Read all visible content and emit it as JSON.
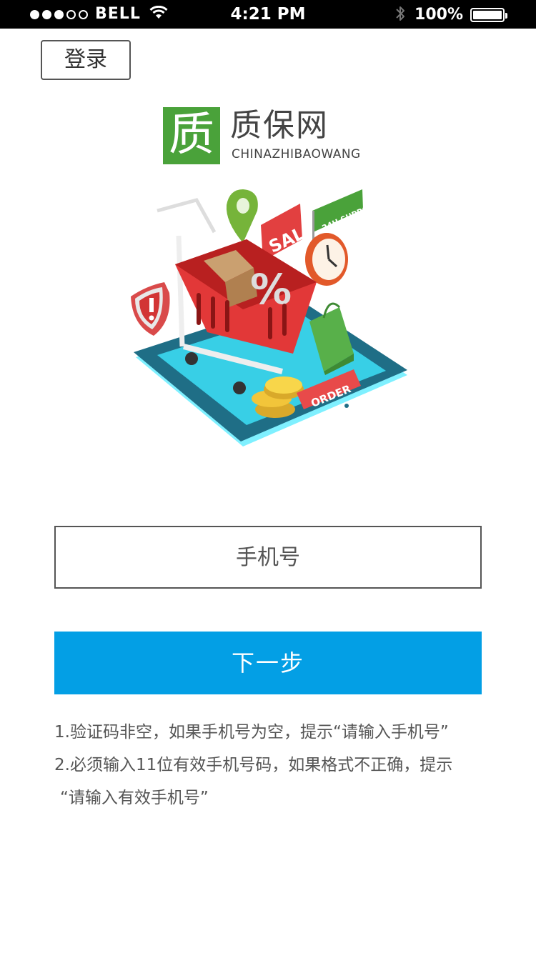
{
  "status_bar": {
    "carrier": "BELL",
    "signal_dots": 5,
    "signal_filled": 3,
    "time": "4:21 PM",
    "battery_percent": "100%",
    "icons": [
      "wifi-icon",
      "bluetooth-icon",
      "battery-icon"
    ]
  },
  "header": {
    "login_label": "登录"
  },
  "logo": {
    "mark": "质",
    "name_cn": "质保网",
    "name_en": "CHINAZHIBAOWANG",
    "brand_color": "#4aa23a"
  },
  "illustration": {
    "labels": {
      "sale": "SALE",
      "support": "24H SUPPORT",
      "percent": "%",
      "order": "ORDER"
    }
  },
  "form": {
    "phone_placeholder": "手机号",
    "phone_value": "",
    "next_label": "下一步",
    "accent_color": "#039fe5"
  },
  "notes": {
    "line1": "1.验证码非空，如果手机号为空，提示“请输入手机号”",
    "line2": "2.必须输入11位有效手机号码，如果格式不正确，提示",
    "line3": "“请输入有效手机号”"
  }
}
